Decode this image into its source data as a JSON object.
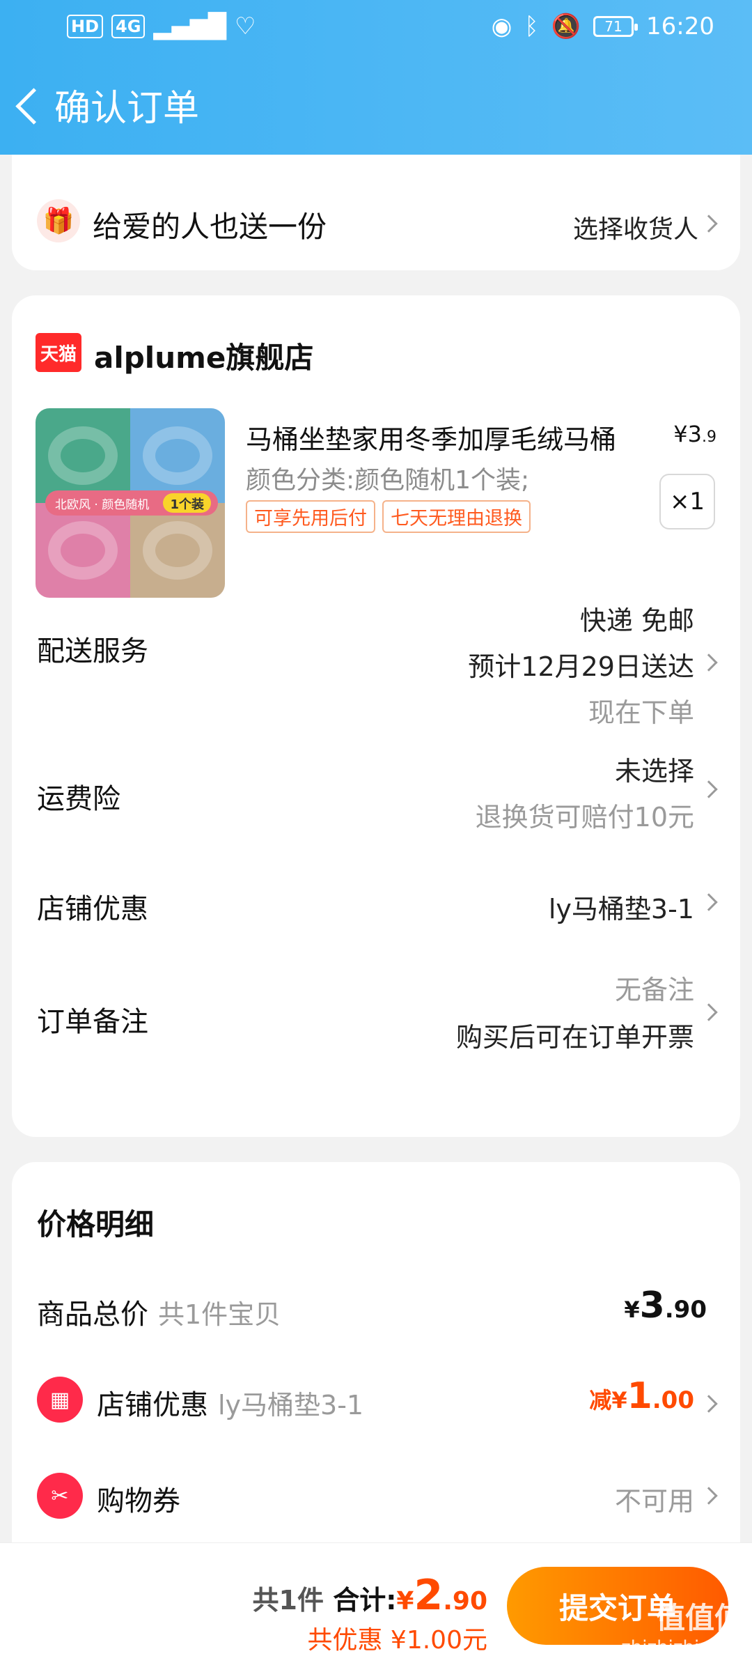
{
  "status_bar": {
    "left_chips": [
      "HD",
      "4G"
    ],
    "battery": "71",
    "time": "16:20"
  },
  "header": {
    "title": "确认订单"
  },
  "gift": {
    "label": "给爱的人也送一份",
    "action": "选择收货人"
  },
  "store": {
    "badge": "天猫",
    "name": "alplume旗舰店"
  },
  "product": {
    "title": "马桶坐垫家用冬季加厚毛绒马桶",
    "price_currency": "¥",
    "price_main": "3",
    "price_cents": ".9",
    "sku": "颜色分类:颜色随机1个装;",
    "tags": [
      "可享先用后付",
      "七天无理由退换"
    ],
    "qty": "×1",
    "image_band": "北欧风 · 颜色随机",
    "image_chip": "1个装"
  },
  "rows": {
    "delivery": {
      "label": "配送服务",
      "line1": "快递 免邮",
      "line2": "预计12月29日送达",
      "line3": "现在下单"
    },
    "insurance": {
      "label": "运费险",
      "line1": "未选择",
      "line2": "退换货可赔付10元"
    },
    "store_discount": {
      "label": "店铺优惠",
      "value": "ly马桶垫3-1"
    },
    "note": {
      "label": "订单备注",
      "line1": "无备注",
      "line2": "购买后可在订单开票"
    }
  },
  "price_detail": {
    "title": "价格明细",
    "goods_total": {
      "label": "商品总价",
      "sub": "共1件宝贝",
      "currency": "¥",
      "main": "3",
      "cents": ".90"
    },
    "store_discount": {
      "label": "店铺优惠",
      "sub": "ly马桶垫3-1",
      "prefix": "减",
      "currency": "¥",
      "main": "1",
      "cents": ".00"
    },
    "coupon": {
      "label": "购物券",
      "value": "不可用"
    }
  },
  "bottom": {
    "count": "共1件",
    "total_label": "合计:",
    "currency": "¥",
    "main": "2",
    "cents": ".90",
    "discount": "共优惠 ¥1.00元",
    "submit": "提交订单"
  },
  "watermark": {
    "big": "值值值",
    "small": "zhizhizhi.com"
  },
  "colors": {
    "header_blue": "#3cb0f2",
    "accent_orange": "#ff4a00",
    "store_red": "#ff2a2a"
  }
}
